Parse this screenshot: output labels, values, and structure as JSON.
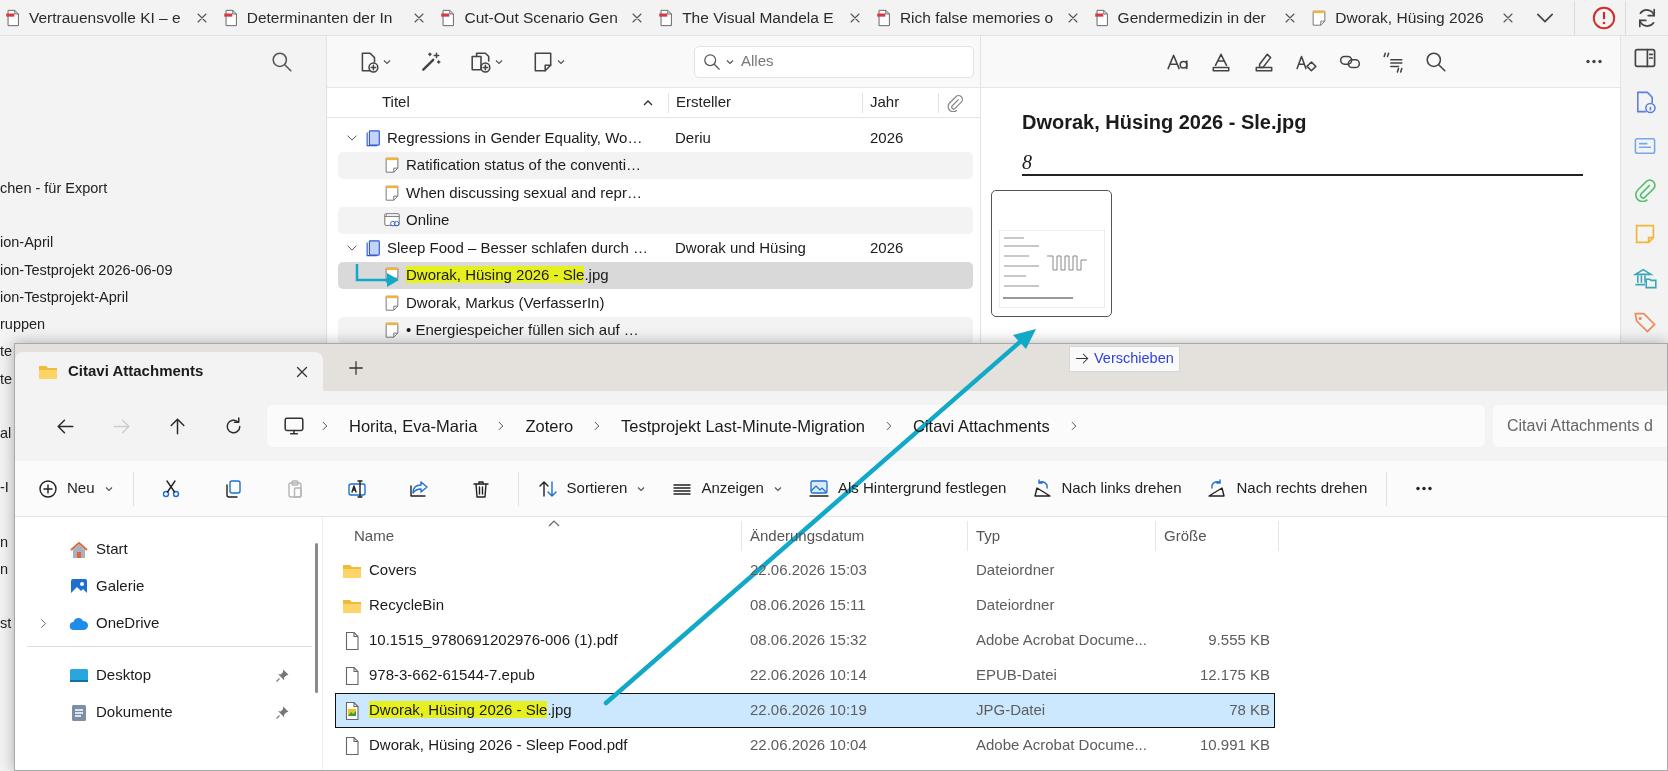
{
  "browser_tabs": [
    {
      "label": "Vertrauensvolle KI – e",
      "kind": "pdf"
    },
    {
      "label": "Determinanten der In",
      "kind": "pdf"
    },
    {
      "label": "Cut-Out Scenario Gen",
      "kind": "pdf"
    },
    {
      "label": "The Visual Mandela E",
      "kind": "pdf"
    },
    {
      "label": "Rich false memories o",
      "kind": "pdf"
    },
    {
      "label": "Gendermedizin in der",
      "kind": "pdf"
    },
    {
      "label": "Dworak, Hüsing 2026",
      "kind": "note"
    }
  ],
  "sidebar": {
    "groups": [
      [
        "chen - für Export"
      ],
      [
        "ion-April",
        "ion-Testprojekt 2026-06-09",
        "ion-Testprojekt-April",
        "ruppen",
        "te",
        "te"
      ],
      [
        "al"
      ],
      [
        "-I"
      ],
      [
        "n",
        "n"
      ],
      [
        "st"
      ]
    ]
  },
  "citavi_toolbar": {
    "buttons": [
      {
        "kind": "add_reference",
        "has_menu": true
      },
      {
        "kind": "magic",
        "has_menu": false
      },
      {
        "kind": "add_copies",
        "has_menu": true
      },
      {
        "kind": "note",
        "has_menu": true
      }
    ],
    "search_placeholder": "Alles"
  },
  "reference_table": {
    "columns": [
      "Titel",
      "Ersteller",
      "Jahr"
    ],
    "rows": [
      {
        "kind": "book",
        "title": "Regressions in Gender Equality, Wo…",
        "creator": "Deriu",
        "year": "2026",
        "expanded": true,
        "selected": false,
        "children": [
          {
            "kind": "note",
            "title": "Ratification status of the conventi…",
            "selected": false
          },
          {
            "kind": "note",
            "title": "When discussing sexual and repr…",
            "selected": false
          },
          {
            "kind": "web",
            "title": "Online",
            "selected": false
          }
        ]
      },
      {
        "kind": "book",
        "title": "Sleep Food – Besser schlafen durch …",
        "creator": "Dworak und Hüsing",
        "year": "2026",
        "expanded": true,
        "selected": false,
        "children": [
          {
            "kind": "note",
            "title_parts": [
              {
                "text": "Dworak, Hüsing 2026 - Sle",
                "highlighted": true
              },
              {
                "text": ".jpg",
                "highlighted": false
              }
            ],
            "selected": true
          },
          {
            "kind": "note",
            "title": "Dworak, Markus (VerfasserIn)",
            "selected": false
          },
          {
            "kind": "note",
            "title": "• Energiespeicher füllen sich auf …",
            "selected": false
          }
        ]
      }
    ]
  },
  "preview": {
    "title": "Dworak, Hüsing 2026 - Sle.jpg",
    "field_value": "8",
    "tooltip": "Verschieben"
  },
  "explorer": {
    "tab": "Citavi Attachments",
    "nav_buttons": [
      {
        "kind": "back",
        "disabled": false
      },
      {
        "kind": "forward",
        "disabled": true
      },
      {
        "kind": "up",
        "disabled": false
      },
      {
        "kind": "refresh",
        "disabled": false
      }
    ],
    "breadcrumb": [
      "Horita, Eva-Maria",
      "Zotero",
      "Testprojekt Last-Minute-Migration",
      "Citavi Attachments"
    ],
    "search_placeholder": "Citavi Attachments d",
    "command_groups": [
      [
        {
          "kind": "new",
          "label": "Neu",
          "has_menu": true,
          "disabled": false
        }
      ],
      [
        {
          "kind": "cut",
          "disabled": false
        },
        {
          "kind": "copy",
          "disabled": false
        },
        {
          "kind": "paste",
          "disabled": true
        },
        {
          "kind": "rename",
          "disabled": false
        },
        {
          "kind": "share",
          "disabled": false
        },
        {
          "kind": "delete",
          "disabled": false
        }
      ],
      [
        {
          "kind": "sort",
          "label": "Sortieren",
          "has_menu": true,
          "disabled": false
        },
        {
          "kind": "view",
          "label": "Anzeigen",
          "has_menu": true,
          "disabled": false
        },
        {
          "kind": "wallpaper",
          "label": "Als Hintergrund festlegen",
          "has_menu": false,
          "disabled": false
        },
        {
          "kind": "rotate_left",
          "label": "Nach links drehen",
          "has_menu": false,
          "disabled": false
        },
        {
          "kind": "rotate_right",
          "label": "Nach rechts drehen",
          "has_menu": false,
          "disabled": false
        }
      ],
      [
        {
          "kind": "more",
          "disabled": false
        }
      ]
    ],
    "nav_groups": [
      [
        {
          "kind": "home",
          "label": "Start",
          "has_children": false,
          "pinned": false
        },
        {
          "kind": "gallery",
          "label": "Galerie",
          "has_children": false,
          "pinned": false
        },
        {
          "kind": "cloud",
          "label": "OneDrive",
          "has_children": true,
          "pinned": false
        }
      ],
      [
        {
          "kind": "desktop",
          "label": "Desktop",
          "has_children": false,
          "pinned": true
        },
        {
          "kind": "documents",
          "label": "Dokumente",
          "has_children": false,
          "pinned": true
        }
      ]
    ],
    "columns": [
      "Name",
      "Änderungsdatum",
      "Typ",
      "Größe"
    ],
    "files": [
      {
        "kind": "folder",
        "name": "Covers",
        "modified": "22.06.2026 15:03",
        "type": "Dateiordner",
        "selected": false
      },
      {
        "kind": "folder",
        "name": "RecycleBin",
        "modified": "08.06.2026 15:11",
        "type": "Dateiordner",
        "selected": false
      },
      {
        "kind": "file",
        "name": "10.1515_9780691202976-006 (1).pdf",
        "modified": "08.06.2026 15:32",
        "type": "Adobe Acrobat Docume...",
        "size": "9.555 KB",
        "selected": false
      },
      {
        "kind": "file",
        "name": "978-3-662-61544-7.epub",
        "modified": "22.06.2026 10:14",
        "type": "EPUB-Datei",
        "size": "12.175 KB",
        "selected": false
      },
      {
        "kind": "image",
        "name_parts": [
          {
            "text": "Dworak, Hüsing 2026 - Sle",
            "highlighted": true
          },
          {
            "text": ".jpg",
            "highlighted": false
          }
        ],
        "modified": "22.06.2026 10:19",
        "type": "JPG-Datei",
        "size": "78 KB",
        "selected": true
      },
      {
        "kind": "file",
        "name": "Dworak, Hüsing 2026 - Sleep Food.pdf",
        "modified": "22.06.2026 10:04",
        "type": "Adobe Acrobat Docume...",
        "size": "10.991 KB",
        "selected": false
      }
    ]
  }
}
